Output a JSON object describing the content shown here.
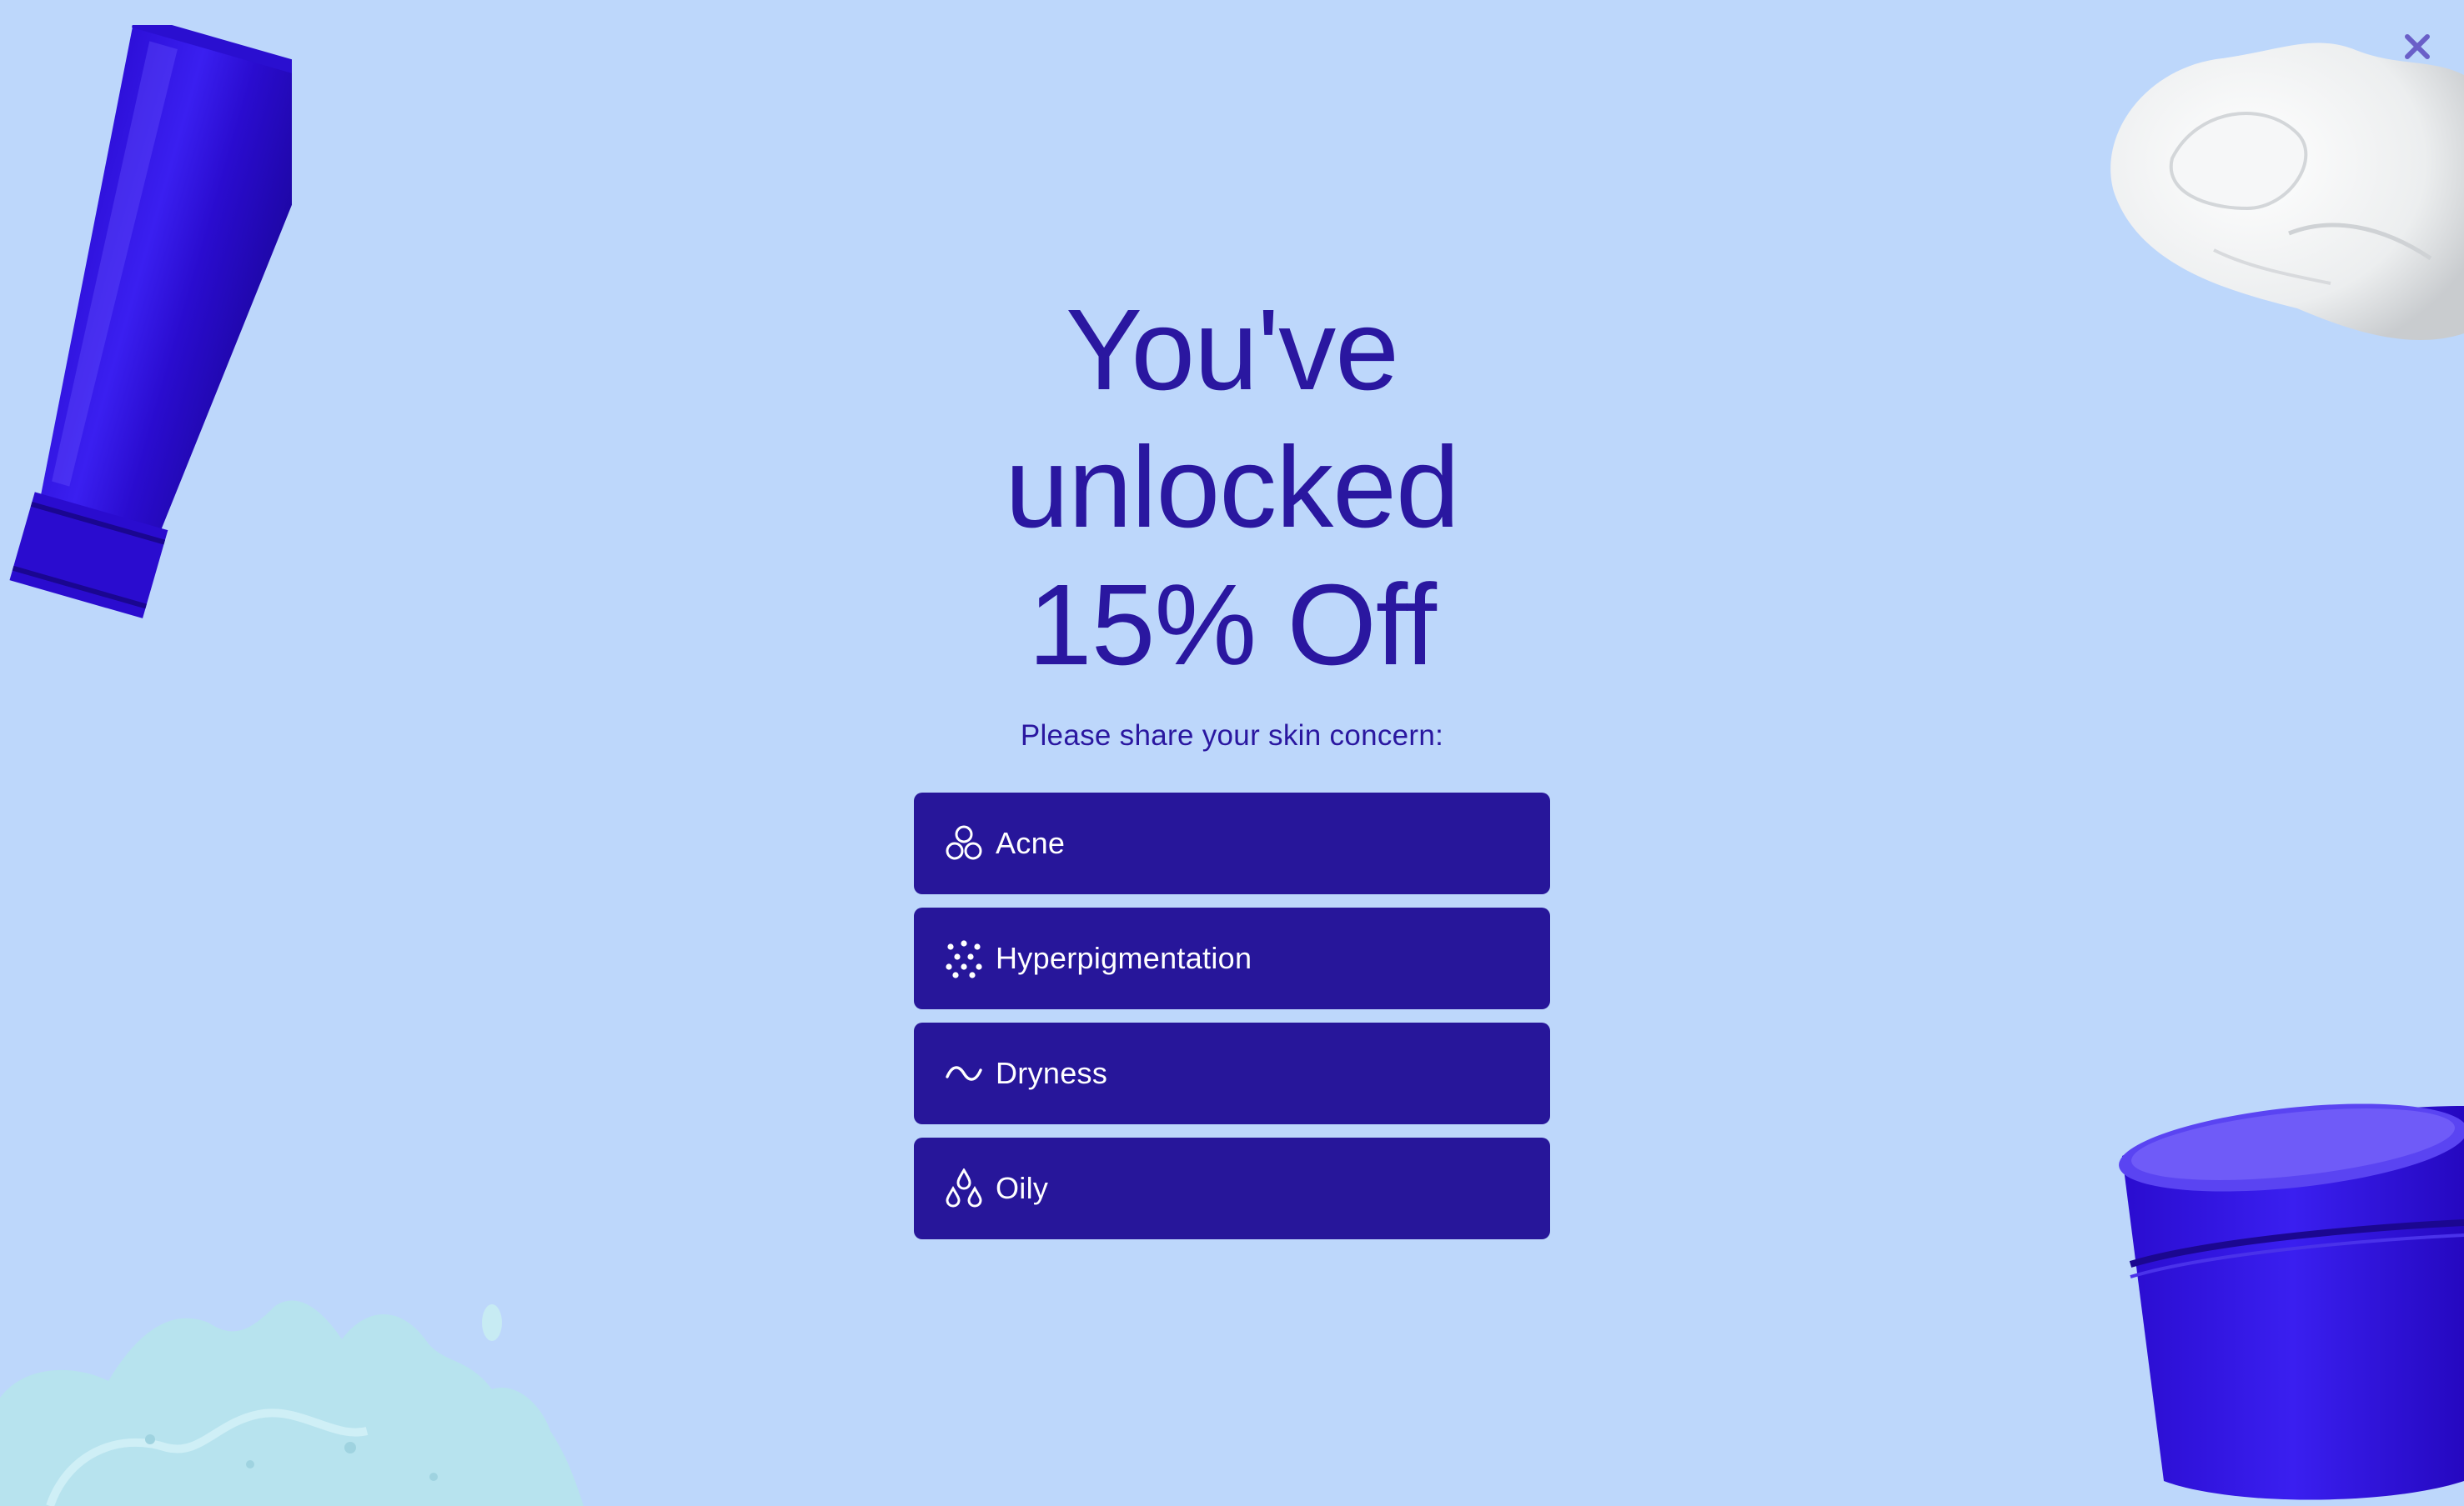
{
  "popup": {
    "headline_lines": [
      "You've",
      "unlocked",
      "15% Off"
    ],
    "subtitle": "Please share your skin concern:",
    "options": [
      {
        "label": "Acne",
        "icon": "circles-icon"
      },
      {
        "label": "Hyperpigmentation",
        "icon": "dots-icon"
      },
      {
        "label": "Dryness",
        "icon": "wave-icon"
      },
      {
        "label": "Oily",
        "icon": "droplets-icon"
      }
    ],
    "close_icon": "close-icon"
  },
  "colors": {
    "background": "#bdd7fb",
    "primary": "#2a17a0",
    "button": "#27169a",
    "button_text": "#ffffff"
  }
}
